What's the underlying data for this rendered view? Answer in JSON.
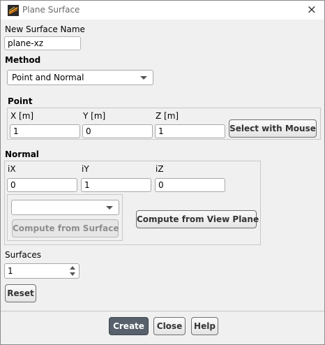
{
  "window": {
    "title": "Plane Surface",
    "close_glyph": "×"
  },
  "new_surface": {
    "label": "New Surface Name",
    "value": "plane-xz"
  },
  "method": {
    "label": "Method",
    "selected": "Point and Normal"
  },
  "point": {
    "label": "Point",
    "x_label": "X [m]",
    "y_label": "Y [m]",
    "z_label": "Z [m]",
    "x": "1",
    "y": "0",
    "z": "1",
    "select_button": "Select with Mouse"
  },
  "normal": {
    "label": "Normal",
    "ix_label": "iX",
    "iy_label": "iY",
    "iz_label": "iZ",
    "ix": "0",
    "iy": "1",
    "iz": "0",
    "surface_dropdown_value": "",
    "compute_surface_button": "Compute from Surface",
    "compute_view_button": "Compute from View Plane"
  },
  "surfaces": {
    "label": "Surfaces",
    "value": "1"
  },
  "reset_button": "Reset",
  "footer": {
    "create": "Create",
    "close": "Close",
    "help": "Help"
  },
  "colors": {
    "primary_button": "#57606b",
    "background": "#f0f0f0"
  }
}
